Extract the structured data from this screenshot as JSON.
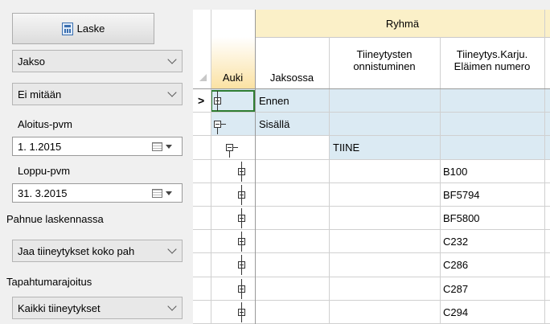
{
  "sidebar": {
    "calc_button": "Laske",
    "period_select": "Jakso",
    "period_type_select": "Ei mitään",
    "start_label": "Aloitus-pvm",
    "start_date": "1. 1.2015",
    "end_label": "Loppu-pvm",
    "end_date": "31. 3.2015",
    "litter_label": "Pahnue laskennassa",
    "litter_select": "Jaa tiineytykset koko pah",
    "event_label": "Tapahtumarajoitus",
    "event_select": "Kaikki tiineytykset"
  },
  "grid": {
    "group_header": "Ryhmä",
    "columns": {
      "auki": "Auki",
      "jaksossa": "Jaksossa",
      "onnistuminen_1": "Tiineytysten",
      "onnistuminen_2": "onnistuminen",
      "numero_1": "Tiineytys.Karju.",
      "numero_2": "Eläimen numero"
    },
    "current_row_marker": ">",
    "rows": [
      {
        "jaksossa": "Ennen",
        "onnistuminen": "",
        "numero": ""
      },
      {
        "jaksossa": "Sisällä",
        "onnistuminen": "",
        "numero": ""
      },
      {
        "jaksossa": "",
        "onnistuminen": "TIINE",
        "numero": ""
      },
      {
        "jaksossa": "",
        "onnistuminen": "",
        "numero": "B100"
      },
      {
        "jaksossa": "",
        "onnistuminen": "",
        "numero": "BF5794"
      },
      {
        "jaksossa": "",
        "onnistuminen": "",
        "numero": "BF5800"
      },
      {
        "jaksossa": "",
        "onnistuminen": "",
        "numero": "C232"
      },
      {
        "jaksossa": "",
        "onnistuminen": "",
        "numero": "C286"
      },
      {
        "jaksossa": "",
        "onnistuminen": "",
        "numero": "C287"
      },
      {
        "jaksossa": "",
        "onnistuminen": "",
        "numero": "C294"
      }
    ]
  },
  "colors": {
    "group_header_bg": "#fbf0c8",
    "auki_header_bg": "#fbe2a3",
    "selected_row_bg": "#dbeaf3",
    "focus_border": "#2e7d32"
  }
}
